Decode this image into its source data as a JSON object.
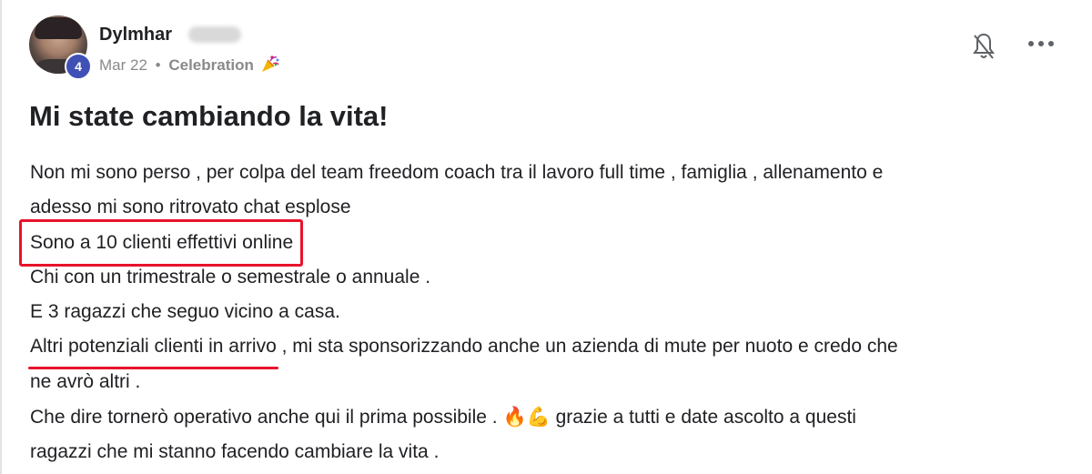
{
  "post": {
    "author": {
      "name": "Dylmhar",
      "level": "4"
    },
    "meta": {
      "date": "Mar 22",
      "separator": "•",
      "category": "Celebration"
    },
    "icons": {
      "notifications": "bell-off-icon",
      "more": "more-options-icon",
      "category": "party-popper-icon"
    },
    "title": "Mi state cambiando la vita!",
    "body": {
      "line1": "Non mi sono perso , per colpa del team freedom coach tra il lavoro full time , famiglia , allenamento e",
      "line2": "adesso mi sono ritrovato chat esplose",
      "line3_boxed": "Sono a 10 clienti effettivi online",
      "line4": "Chi con un trimestrale o semestrale o annuale .",
      "line5": "E 3 ragazzi che seguo vicino a casa.",
      "line6_underlined": "Altri potenziali clienti in arrivo",
      "line6_rest": " , mi sta sponsorizzando anche un azienda di mute per nuoto e credo che",
      "line7": "ne avrò altri .",
      "line8_start": "Che dire tornerò operativo anche qui il prima possibile . ",
      "line8_emoji": "🔥💪",
      "line8_end": " grazie a tutti e date ascolto a questi",
      "line9": "ragazzi che mi stanno facendo cambiare la vita ."
    },
    "annotation_color": "#e8132b",
    "badge_color": "#3f51b5"
  }
}
